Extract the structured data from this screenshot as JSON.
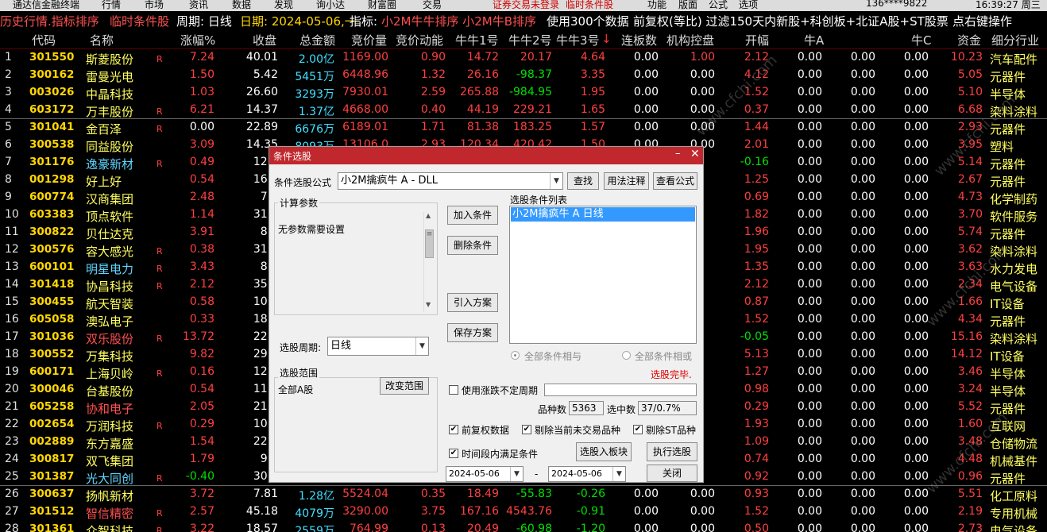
{
  "menubar": {
    "items": [
      "通达信金融终端",
      "行情",
      "市场",
      "资讯",
      "数据",
      "发现",
      "询小达",
      "财富圈",
      "交易"
    ],
    "right_items": [
      "功能",
      "版面",
      "公式",
      "选项"
    ],
    "notice": "证券交易未登录",
    "notice2": "临时条件股",
    "phone": "136****9822",
    "clock": "16:39:27 周三"
  },
  "titlebar": {
    "seg1": "历史行情.指标排序",
    "seg2": "临时条件股",
    "seg3": "周期: 日线",
    "seg4": "日期: 2024-05-06,一",
    "seg5": "指标:",
    "seg6": "小2M牛牛排序 小2M牛B排序",
    "seg7": "使用300个数据",
    "seg8": "前复权(等比) 过滤150天内新股+科创板+北证A股+ST股票",
    "seg9": "点右键操作"
  },
  "header": {
    "code": "代码",
    "name": "名称",
    "change": "涨幅%",
    "close": "收盘",
    "amount": "总金额",
    "bid_price": "竞价量",
    "bid_momentum": "竞价动能",
    "nn1": "牛牛1号",
    "nn2": "牛牛2号",
    "nn3": "牛牛3号",
    "nn3_arrow": "↓",
    "lianban": "连板数",
    "jigou": "机构控盘",
    "open": "开幅",
    "niuA": "牛A",
    "niuC": "牛C",
    "fund": "资金",
    "industry": "细分行业"
  },
  "colors": {
    "bg": "#000000",
    "up": "#ff4040",
    "down": "#00e000",
    "code": "#ffd700",
    "dialog_title": "#c0282e"
  },
  "rows": [
    {
      "i": "1",
      "code": "301550",
      "name": "斯菱股份",
      "r": "R",
      "chg": "7.24",
      "close": "40.01",
      "amt": "2.00亿",
      "bidv": "1169.00",
      "bidm": "0.90",
      "n1": "14.72",
      "n2": "20.17",
      "n3": "4.64",
      "lb": "0.00",
      "jg": "1.00",
      "open": "2.12",
      "na": "0.00",
      "nb": "0.00",
      "nc": "0.00",
      "fund": "10.23",
      "ind": "汽车配件"
    },
    {
      "i": "2",
      "code": "300162",
      "name": "雷曼光电",
      "r": "",
      "chg": "1.50",
      "close": "5.42",
      "amt": "5451万",
      "bidv": "6448.96",
      "bidm": "1.32",
      "n1": "26.16",
      "n2": "-98.37",
      "n3": "3.35",
      "lb": "0.00",
      "jg": "0.00",
      "open": "4.12",
      "na": "0.00",
      "nb": "0.00",
      "nc": "0.00",
      "fund": "5.05",
      "ind": "元器件"
    },
    {
      "i": "3",
      "code": "003026",
      "name": "中晶科技",
      "r": "",
      "chg": "1.03",
      "close": "26.60",
      "amt": "3293万",
      "bidv": "7930.01",
      "bidm": "2.59",
      "n1": "265.88",
      "n2": "-984.95",
      "n3": "1.95",
      "lb": "0.00",
      "jg": "0.00",
      "open": "1.52",
      "na": "0.00",
      "nb": "0.00",
      "nc": "0.00",
      "fund": "5.10",
      "ind": "半导体"
    },
    {
      "i": "4",
      "code": "603172",
      "name": "万丰股份",
      "r": "R",
      "chg": "6.21",
      "close": "14.37",
      "amt": "1.37亿",
      "bidv": "4668.00",
      "bidm": "0.40",
      "n1": "44.19",
      "n2": "229.21",
      "n3": "1.65",
      "lb": "0.00",
      "jg": "0.00",
      "open": "0.37",
      "na": "0.00",
      "nb": "0.00",
      "nc": "0.00",
      "fund": "6.68",
      "ind": "染料涂料"
    },
    {
      "i": "5",
      "code": "301041",
      "name": "金百泽",
      "r": "R",
      "chg": "0.00",
      "close": "22.89",
      "amt": "6676万",
      "bidv": "6189.01",
      "bidm": "1.71",
      "n1": "81.38",
      "n2": "183.25",
      "n3": "1.57",
      "lb": "0.00",
      "jg": "0.00",
      "open": "1.44",
      "na": "0.00",
      "nb": "0.00",
      "nc": "0.00",
      "fund": "2.93",
      "ind": "元器件"
    },
    {
      "i": "6",
      "code": "300538",
      "name": "同益股份",
      "r": "",
      "chg": "3.09",
      "close": "14.35",
      "amt": "8093万",
      "bidv": "13106.0",
      "bidm": "2.93",
      "n1": "120.34",
      "n2": "420.42",
      "n3": "1.50",
      "lb": "0.00",
      "jg": "0.00",
      "open": "2.01",
      "na": "0.00",
      "nb": "0.00",
      "nc": "0.00",
      "fund": "3.95",
      "ind": "塑料"
    },
    {
      "i": "7",
      "code": "301176",
      "name": "逸豪新材",
      "r": "R",
      "chg": "0.49",
      "close": "12.2",
      "amt": "",
      "bidv": "",
      "bidm": "",
      "n1": "",
      "n2": "",
      "n3": "",
      "lb": "",
      "jg": "",
      "open": "-0.16",
      "na": "0.00",
      "nb": "0.00",
      "nc": "0.00",
      "fund": "5.14",
      "ind": "元器件"
    },
    {
      "i": "8",
      "code": "001298",
      "name": "好上好",
      "r": "",
      "chg": "0.54",
      "close": "16.8",
      "amt": "",
      "bidv": "",
      "bidm": "",
      "n1": "",
      "n2": "",
      "n3": "",
      "lb": "",
      "jg": "",
      "open": "1.25",
      "na": "0.00",
      "nb": "0.00",
      "nc": "0.00",
      "fund": "2.67",
      "ind": "元器件"
    },
    {
      "i": "9",
      "code": "600774",
      "name": "汉商集团",
      "r": "",
      "chg": "2.48",
      "close": "7.4",
      "amt": "",
      "bidv": "",
      "bidm": "",
      "n1": "",
      "n2": "",
      "n3": "",
      "lb": "",
      "jg": "",
      "open": "0.69",
      "na": "0.00",
      "nb": "0.00",
      "nc": "0.00",
      "fund": "4.73",
      "ind": "化学制药"
    },
    {
      "i": "10",
      "code": "603383",
      "name": "顶点软件",
      "r": "",
      "chg": "1.14",
      "close": "31.1",
      "amt": "",
      "bidv": "",
      "bidm": "",
      "n1": "",
      "n2": "",
      "n3": "",
      "lb": "",
      "jg": "",
      "open": "1.82",
      "na": "0.00",
      "nb": "0.00",
      "nc": "0.00",
      "fund": "3.70",
      "ind": "软件服务"
    },
    {
      "i": "11",
      "code": "300822",
      "name": "贝仕达克",
      "r": "",
      "chg": "3.91",
      "close": "8.5",
      "amt": "",
      "bidv": "",
      "bidm": "",
      "n1": "",
      "n2": "",
      "n3": "",
      "lb": "",
      "jg": "",
      "open": "1.96",
      "na": "0.00",
      "nb": "0.00",
      "nc": "0.00",
      "fund": "5.74",
      "ind": "元器件"
    },
    {
      "i": "12",
      "code": "300576",
      "name": "容大感光",
      "r": "R",
      "chg": "0.38",
      "close": "31.8",
      "amt": "",
      "bidv": "",
      "bidm": "",
      "n1": "",
      "n2": "",
      "n3": "",
      "lb": "",
      "jg": "",
      "open": "1.95",
      "na": "0.00",
      "nb": "0.00",
      "nc": "0.00",
      "fund": "3.62",
      "ind": "染料涂料"
    },
    {
      "i": "13",
      "code": "600101",
      "name": "明星电力",
      "r": "R",
      "chg": "3.43",
      "close": "8.4",
      "amt": "",
      "bidv": "",
      "bidm": "",
      "n1": "",
      "n2": "",
      "n3": "",
      "lb": "",
      "jg": "",
      "open": "1.35",
      "na": "0.00",
      "nb": "0.00",
      "nc": "0.00",
      "fund": "3.63",
      "ind": "水力发电"
    },
    {
      "i": "14",
      "code": "301418",
      "name": "协昌科技",
      "r": "R",
      "chg": "2.12",
      "close": "35.7",
      "amt": "",
      "bidv": "",
      "bidm": "",
      "n1": "",
      "n2": "",
      "n3": "",
      "lb": "",
      "jg": "",
      "open": "2.12",
      "na": "0.00",
      "nb": "0.00",
      "nc": "0.00",
      "fund": "2.34",
      "ind": "电气设备"
    },
    {
      "i": "15",
      "code": "300455",
      "name": "航天智装",
      "r": "",
      "chg": "0.58",
      "close": "10.4",
      "amt": "",
      "bidv": "",
      "bidm": "",
      "n1": "",
      "n2": "",
      "n3": "",
      "lb": "",
      "jg": "",
      "open": "0.87",
      "na": "0.00",
      "nb": "0.00",
      "nc": "0.00",
      "fund": "1.66",
      "ind": "IT设备"
    },
    {
      "i": "16",
      "code": "605058",
      "name": "澳弘电子",
      "r": "",
      "chg": "0.33",
      "close": "18.4",
      "amt": "",
      "bidv": "",
      "bidm": "",
      "n1": "",
      "n2": "",
      "n3": "",
      "lb": "",
      "jg": "",
      "open": "1.52",
      "na": "0.00",
      "nb": "0.00",
      "nc": "0.00",
      "fund": "4.34",
      "ind": "元器件"
    },
    {
      "i": "17",
      "code": "301036",
      "name": "双乐股份",
      "r": "R",
      "chg": "13.72",
      "close": "22.8",
      "amt": "",
      "bidv": "",
      "bidm": "",
      "n1": "",
      "n2": "",
      "n3": "",
      "lb": "",
      "jg": "",
      "open": "-0.05",
      "na": "0.00",
      "nb": "0.00",
      "nc": "0.00",
      "fund": "15.16",
      "ind": "染料涂料"
    },
    {
      "i": "18",
      "code": "300552",
      "name": "万集科技",
      "r": "",
      "chg": "9.82",
      "close": "29.9",
      "amt": "",
      "bidv": "",
      "bidm": "",
      "n1": "",
      "n2": "",
      "n3": "",
      "lb": "",
      "jg": "",
      "open": "5.13",
      "na": "0.00",
      "nb": "0.00",
      "nc": "0.00",
      "fund": "14.12",
      "ind": "IT设备"
    },
    {
      "i": "19",
      "code": "600171",
      "name": "上海贝岭",
      "r": "R",
      "chg": "0.16",
      "close": "12.6",
      "amt": "",
      "bidv": "",
      "bidm": "",
      "n1": "",
      "n2": "",
      "n3": "",
      "lb": "",
      "jg": "",
      "open": "1.27",
      "na": "0.00",
      "nb": "0.00",
      "nc": "0.00",
      "fund": "3.46",
      "ind": "半导体"
    },
    {
      "i": "20",
      "code": "300046",
      "name": "台基股份",
      "r": "",
      "chg": "0.54",
      "close": "11.2",
      "amt": "",
      "bidv": "",
      "bidm": "",
      "n1": "",
      "n2": "",
      "n3": "",
      "lb": "",
      "jg": "",
      "open": "0.98",
      "na": "0.00",
      "nb": "0.00",
      "nc": "0.00",
      "fund": "3.24",
      "ind": "半导体"
    },
    {
      "i": "21",
      "code": "605258",
      "name": "协和电子",
      "r": "",
      "chg": "2.05",
      "close": "21.4",
      "amt": "",
      "bidv": "",
      "bidm": "",
      "n1": "",
      "n2": "",
      "n3": "",
      "lb": "",
      "jg": "",
      "open": "0.29",
      "na": "0.00",
      "nb": "0.00",
      "nc": "0.00",
      "fund": "5.52",
      "ind": "元器件"
    },
    {
      "i": "22",
      "code": "002654",
      "name": "万润科技",
      "r": "R",
      "chg": "0.29",
      "close": "10.3",
      "amt": "",
      "bidv": "",
      "bidm": "",
      "n1": "",
      "n2": "",
      "n3": "",
      "lb": "",
      "jg": "",
      "open": "1.93",
      "na": "0.00",
      "nb": "0.00",
      "nc": "0.00",
      "fund": "1.60",
      "ind": "互联网"
    },
    {
      "i": "23",
      "code": "002889",
      "name": "东方嘉盛",
      "r": "",
      "chg": "1.54",
      "close": "22.2",
      "amt": "",
      "bidv": "",
      "bidm": "",
      "n1": "",
      "n2": "",
      "n3": "",
      "lb": "",
      "jg": "",
      "open": "1.09",
      "na": "0.00",
      "nb": "0.00",
      "nc": "0.00",
      "fund": "3.48",
      "ind": "仓储物流"
    },
    {
      "i": "24",
      "code": "300817",
      "name": "双飞集团",
      "r": "",
      "chg": "1.79",
      "close": "9.6",
      "amt": "",
      "bidv": "",
      "bidm": "",
      "n1": "",
      "n2": "",
      "n3": "",
      "lb": "",
      "jg": "",
      "open": "0.74",
      "na": "0.00",
      "nb": "0.00",
      "nc": "0.00",
      "fund": "4.48",
      "ind": "机械基件"
    },
    {
      "i": "25",
      "code": "301387",
      "name": "光大同创",
      "r": "R",
      "chg": "-0.40",
      "close": "30.1",
      "amt": "",
      "bidv": "",
      "bidm": "",
      "n1": "",
      "n2": "",
      "n3": "",
      "lb": "",
      "jg": "",
      "open": "0.92",
      "na": "0.00",
      "nb": "0.00",
      "nc": "0.00",
      "fund": "0.96",
      "ind": "元器件"
    },
    {
      "i": "26",
      "code": "300637",
      "name": "扬帆新材",
      "r": "",
      "chg": "3.72",
      "close": "7.81",
      "amt": "1.28亿",
      "bidv": "5524.04",
      "bidm": "0.35",
      "n1": "18.49",
      "n2": "-55.83",
      "n3": "-0.26",
      "lb": "0.00",
      "jg": "0.00",
      "open": "0.93",
      "na": "0.00",
      "nb": "0.00",
      "nc": "0.00",
      "fund": "5.51",
      "ind": "化工原料"
    },
    {
      "i": "27",
      "code": "301512",
      "name": "智信精密",
      "r": "R",
      "chg": "2.57",
      "close": "45.18",
      "amt": "4079万",
      "bidv": "3290.00",
      "bidm": "3.75",
      "n1": "167.16",
      "n2": "4543.76",
      "n3": "-0.91",
      "lb": "0.00",
      "jg": "0.00",
      "open": "1.52",
      "na": "0.00",
      "nb": "0.00",
      "nc": "0.00",
      "fund": "2.19",
      "ind": "专用机械"
    },
    {
      "i": "28",
      "code": "301361",
      "name": "众智科技",
      "r": "R",
      "chg": "3.22",
      "close": "18.57",
      "amt": "2559万",
      "bidv": "764.99",
      "bidm": "0.13",
      "n1": "20.49",
      "n2": "-60.98",
      "n3": "-1.20",
      "lb": "0.00",
      "jg": "0.00",
      "open": "0.50",
      "na": "0.00",
      "nb": "0.00",
      "nc": "0.00",
      "fund": "2.73",
      "ind": "电气设备"
    }
  ],
  "dialog": {
    "title": "条件选股",
    "min": "–",
    "close": "✕",
    "formula_label": "条件选股公式",
    "formula_value": "小2M擒疯牛 A  -  DLL",
    "btn_find": "查找",
    "btn_usage": "用法注释",
    "btn_view": "查看公式",
    "params_title": "计算参数",
    "params_text": "无参数需要设置",
    "period_label": "选股周期:",
    "period_value": "日线",
    "range_title": "选股范围",
    "range_value": "全部A股",
    "btn_change_range": "改变范围",
    "btn_add": "加入条件",
    "btn_delete": "删除条件",
    "btn_import": "引入方案",
    "btn_save": "保存方案",
    "list_title": "选股条件列表",
    "list_items": [
      "小2M擒疯牛 A  日线"
    ],
    "radio_and": "全部条件相与",
    "radio_or": "全部条件相或",
    "status": "选股完毕.",
    "chk_uncertain": "使用涨跌不定周期",
    "count_label": "品种数",
    "count_value": "5363",
    "selected_label": "选中数",
    "selected_value": "37/0.7%",
    "chk_fq": "前复权数据",
    "chk_excl_untraded": "剔除当前未交易品种",
    "chk_excl_st": "剔除ST品种",
    "chk_range": "时间段内满足条件",
    "btn_to_block": "选股入板块",
    "btn_run": "执行选股",
    "date_from": "2024-05-06",
    "date_sep": "-",
    "date_to": "2024-05-06",
    "btn_close": "关闭"
  },
  "watermark": "www.cfchi.com"
}
